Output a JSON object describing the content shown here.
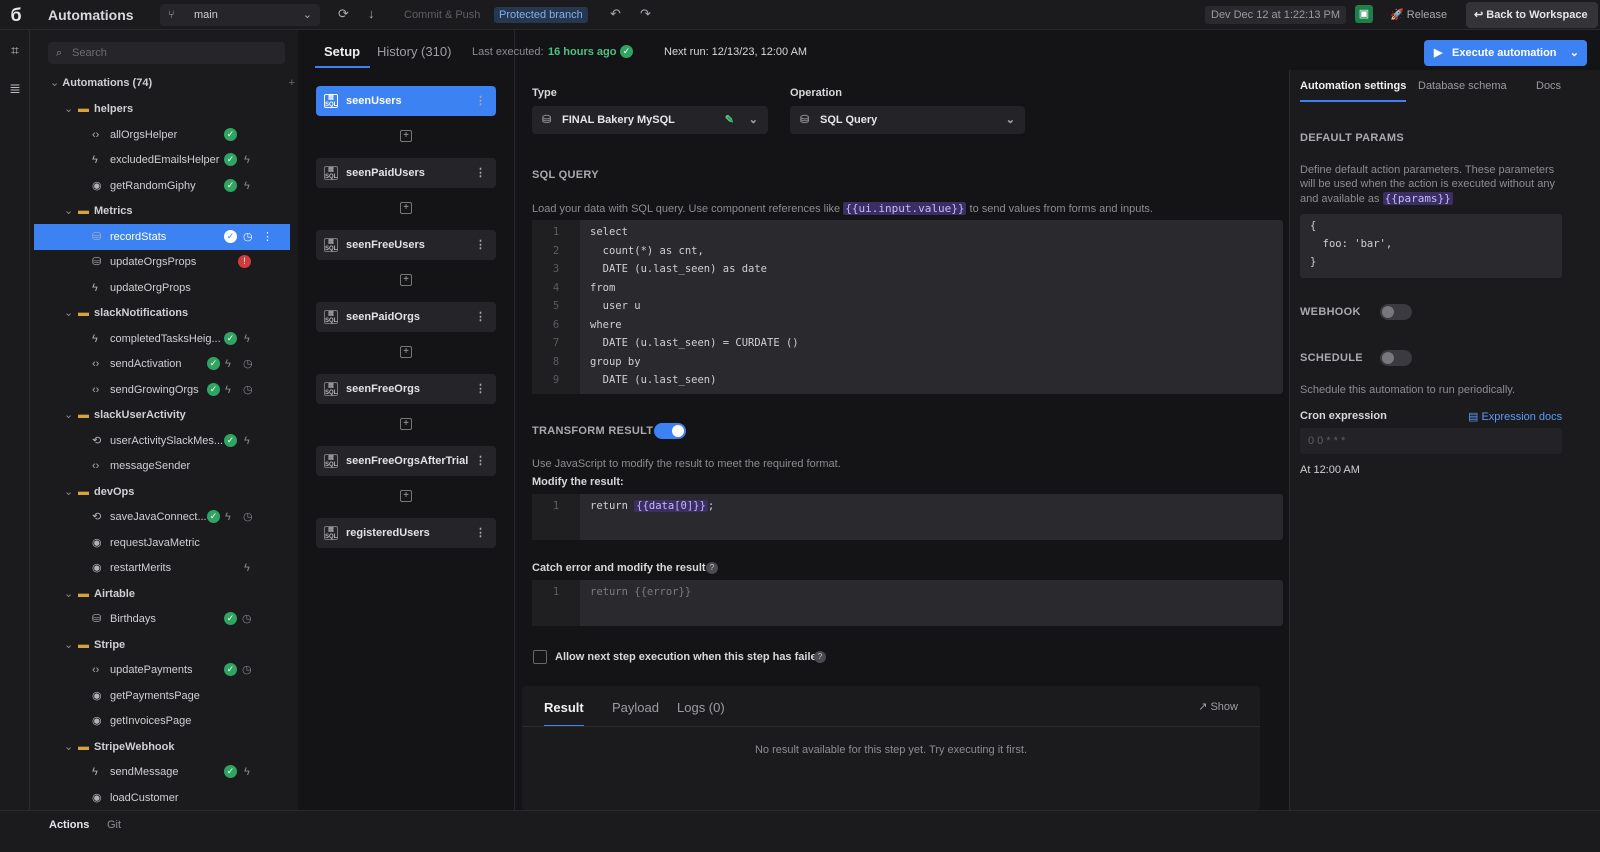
{
  "header": {
    "app_title": "Automations",
    "branch": "main",
    "commit_push": "Commit & Push",
    "protected_branch": "Protected branch",
    "datetime": "Dev Dec 12 at 1:22:13 PM",
    "release": "Release",
    "back_to_workspace": "Back to Workspace"
  },
  "sidebar": {
    "search_placeholder": "Search",
    "root": "Automations (74)",
    "items": [
      {
        "label": "helpers",
        "type": "folder"
      },
      {
        "label": "allOrgsHelper",
        "type": "code"
      },
      {
        "label": "excludedEmailsHelper",
        "type": "bolt"
      },
      {
        "label": "getRandomGiphy",
        "type": "api"
      },
      {
        "label": "Metrics",
        "type": "folder"
      },
      {
        "label": "recordStats",
        "type": "sql"
      },
      {
        "label": "updateOrgsProps",
        "type": "sql"
      },
      {
        "label": "updateOrgProps",
        "type": "bolt"
      },
      {
        "label": "slackNotifications",
        "type": "folder"
      },
      {
        "label": "completedTasksHeig...",
        "type": "bolt"
      },
      {
        "label": "sendActivation",
        "type": "code"
      },
      {
        "label": "sendGrowingOrgs",
        "type": "code"
      },
      {
        "label": "slackUserActivity",
        "type": "folder"
      },
      {
        "label": "userActivitySlackMes...",
        "type": "loop"
      },
      {
        "label": "messageSender",
        "type": "code"
      },
      {
        "label": "devOps",
        "type": "folder"
      },
      {
        "label": "saveJavaConnect...",
        "type": "loop"
      },
      {
        "label": "requestJavaMetric",
        "type": "api"
      },
      {
        "label": "restartMerits",
        "type": "api"
      },
      {
        "label": "Airtable",
        "type": "folder"
      },
      {
        "label": "Birthdays",
        "type": "sql"
      },
      {
        "label": "Stripe",
        "type": "folder"
      },
      {
        "label": "updatePayments",
        "type": "code"
      },
      {
        "label": "getPaymentsPage",
        "type": "api"
      },
      {
        "label": "getInvoicesPage",
        "type": "api"
      },
      {
        "label": "StripeWebhook",
        "type": "folder"
      },
      {
        "label": "sendMessage",
        "type": "bolt"
      },
      {
        "label": "loadCustomer",
        "type": "api"
      }
    ],
    "error_count": "!"
  },
  "tabs": {
    "setup": "Setup",
    "history": "History (310)",
    "last_executed_label": "Last executed:",
    "last_executed_value": "16 hours ago",
    "next_run": "Next run: 12/13/23, 12:00 AM"
  },
  "steps": [
    "seenUsers",
    "seenPaidUsers",
    "seenFreeUsers",
    "seenPaidOrgs",
    "seenFreeOrgs",
    "seenFreeOrgsAfterTrial",
    "registeredUsers"
  ],
  "main": {
    "type_label": "Type",
    "type_value": "FINAL Bakery MySQL",
    "operation_label": "Operation",
    "operation_value": "SQL Query",
    "sql_section": "SQL QUERY",
    "sql_help_prefix": "Load your data with SQL query. Use component references like",
    "sql_help_tag": "{{ui.input.value}}",
    "sql_help_suffix": "to send values from forms and inputs.",
    "sql_lines": [
      "select",
      "  count(*) as cnt,",
      "  DATE (u.last_seen) as date",
      "from",
      "  user u",
      "where",
      "  DATE (u.last_seen) = CURDATE ()",
      "group by",
      "  DATE (u.last_seen)"
    ],
    "transform_label": "TRANSFORM RESULT",
    "transform_help": "Use JavaScript to modify the result to meet the required format.",
    "modify_label": "Modify the result:",
    "modify_code_prefix": "return",
    "modify_code_tag": "{{data[0]}}",
    "modify_code_suffix": ";",
    "catch_label": "Catch error and modify the result:",
    "catch_code": "return {{error}}",
    "allow_next": "Allow next step execution when this step has failed",
    "result_tabs": [
      "Result",
      "Payload",
      "Logs (0)"
    ],
    "show": "Show",
    "no_result": "No result available for this step yet. Try executing it first."
  },
  "right": {
    "execute": "Execute automation",
    "tabs": [
      "Automation settings",
      "Database schema",
      "Docs"
    ],
    "default_params": "DEFAULT PARAMS",
    "params_help_1": "Define default action parameters. These parameters",
    "params_help_2": "will be used when the action is executed without any",
    "params_help_3": "and available as",
    "params_tag": "{{params}}",
    "params_code": [
      "{",
      "  foo: 'bar',",
      "}"
    ],
    "webhook": "WEBHOOK",
    "schedule": "SCHEDULE",
    "schedule_help": "Schedule this automation to run periodically.",
    "cron_label": "Cron expression",
    "expression_docs": "Expression docs",
    "cron_value": "0 0 * * *",
    "cron_human": "At 12:00 AM"
  },
  "bottom": {
    "actions": "Actions",
    "git": "Git"
  }
}
